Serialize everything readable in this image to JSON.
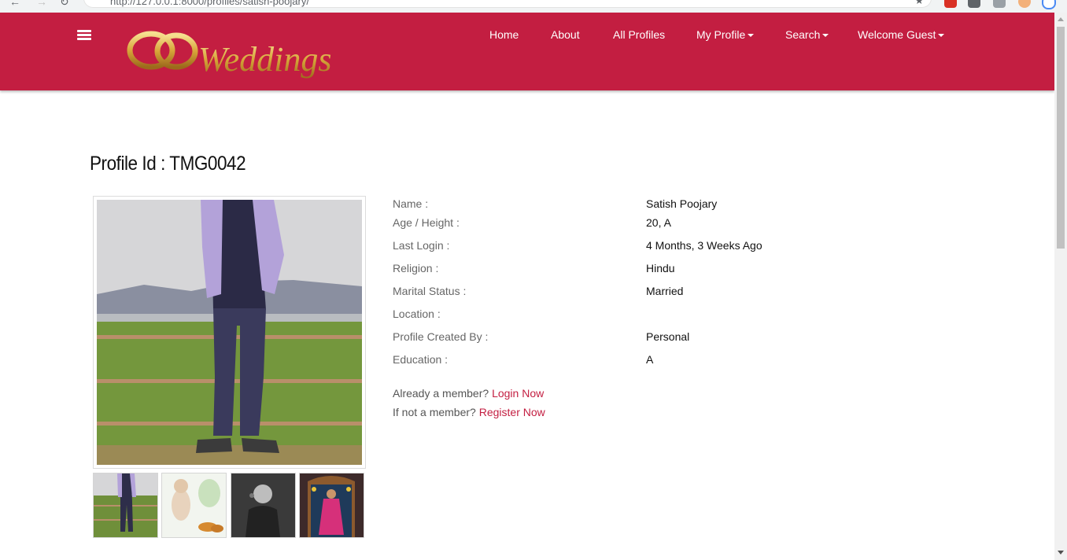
{
  "browser": {
    "url": "http://127.0.0.1:8000/profiles/satish-poojary/"
  },
  "header": {
    "logo_text": "Weddings",
    "nav": [
      {
        "label": "Home",
        "dropdown": false
      },
      {
        "label": "About",
        "dropdown": false
      },
      {
        "label": "All Profiles",
        "dropdown": false
      },
      {
        "label": "My Profile",
        "dropdown": true
      },
      {
        "label": "Search",
        "dropdown": true
      },
      {
        "label": "Welcome Guest",
        "dropdown": true
      }
    ]
  },
  "profile": {
    "title": "Profile Id : TMG0042",
    "details": [
      {
        "label": "Name :",
        "value": "Satish Poojary"
      },
      {
        "label": "Age / Height :",
        "value": "20, A"
      },
      {
        "label": "Last Login :",
        "value": "4 Months, 3 Weeks Ago"
      },
      {
        "label": "Religion :",
        "value": "Hindu"
      },
      {
        "label": "Marital Status :",
        "value": "Married"
      },
      {
        "label": "Location :",
        "value": ""
      },
      {
        "label": "Profile Created By :",
        "value": "Personal"
      },
      {
        "label": "Education :",
        "value": "A"
      }
    ],
    "member_prompt": {
      "text": "Already a member?",
      "link": "Login Now"
    },
    "register_prompt": {
      "text": "If not a member?",
      "link": "Register Now"
    }
  },
  "colors": {
    "brand": "#c31e41",
    "gold": "#d6a93b"
  }
}
